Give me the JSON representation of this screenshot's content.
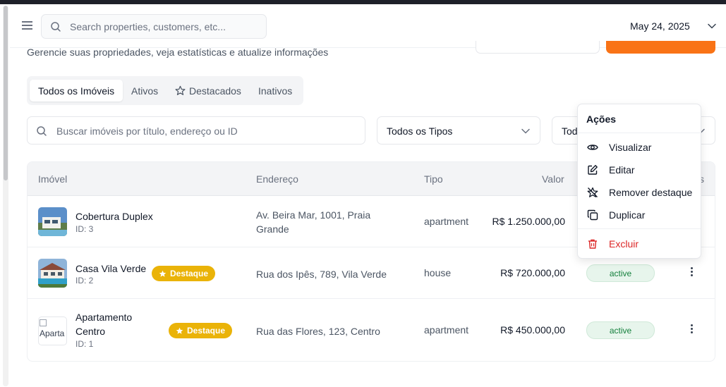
{
  "header": {
    "search_placeholder": "Search properties, customers, etc...",
    "date": "May 24, 2025"
  },
  "page": {
    "subtitle": "Gerencie suas propriedades, veja estatísticas e atualize informações"
  },
  "tabs": [
    {
      "label": "Todos os Imóveis",
      "active": true
    },
    {
      "label": "Ativos",
      "active": false
    },
    {
      "label": "Destacados",
      "active": false,
      "icon": "star-icon"
    },
    {
      "label": "Inativos",
      "active": false
    }
  ],
  "filters": {
    "search_placeholder": "Buscar imóveis por título, endereço ou ID",
    "type_select": "Todos os Tipos",
    "status_select": "Tod"
  },
  "table": {
    "columns": [
      "Imóvel",
      "Endereço",
      "Tipo",
      "Valor",
      "s"
    ],
    "rows": [
      {
        "name": "Cobertura Duplex",
        "id": "ID: 3",
        "featured": false,
        "address": "Av. Beira Mar, 1001, Praia Grande",
        "type": "apartment",
        "price": "R$ 1.250.000,00",
        "status": ""
      },
      {
        "name": "Casa Vila Verde",
        "id": "ID: 2",
        "featured": true,
        "address": "Rua dos Ipês, 789, Vila Verde",
        "type": "house",
        "price": "R$ 720.000,00",
        "status": "active"
      },
      {
        "name": "Apartamento Centro",
        "id": "ID: 1",
        "featured": true,
        "address": "Rua das Flores, 123, Centro",
        "type": "apartment",
        "price": "R$ 450.000,00",
        "status": "active",
        "image_alt": "Aparta"
      }
    ],
    "badge_label": "Destaque"
  },
  "actions_menu": {
    "title": "Ações",
    "items": [
      {
        "label": "Visualizar",
        "icon": "eye-icon"
      },
      {
        "label": "Editar",
        "icon": "edit-icon"
      },
      {
        "label": "Remover destaque",
        "icon": "star-off-icon"
      },
      {
        "label": "Duplicar",
        "icon": "copy-icon"
      },
      {
        "label": "Excluir",
        "icon": "trash-icon",
        "color": "#dc2626"
      }
    ]
  },
  "colors": {
    "accent": "#f97316",
    "badge": "#eab308",
    "status_active": "#15803d",
    "danger": "#dc2626"
  }
}
